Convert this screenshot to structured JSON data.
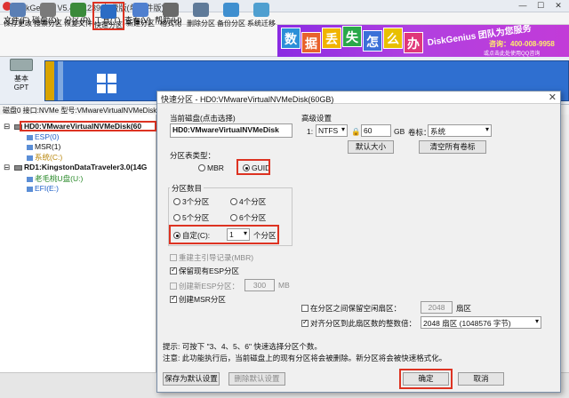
{
  "window": {
    "title": "DiskGenius V5.4.2.1239 免费版(单文件版)",
    "min": "—",
    "max": "☐",
    "close": "✕"
  },
  "menu": [
    "文件(F)",
    "磁盘(D)",
    "分区(P)",
    "工具(T)",
    "查看(V)",
    "帮助(H)"
  ],
  "toolbar": [
    {
      "label": "保存更改",
      "icon": "save-icon",
      "color": "#5a7fb5"
    },
    {
      "label": "搜索分区",
      "icon": "search-partition-icon",
      "color": "#7a7a7a"
    },
    {
      "label": "恢复文件",
      "icon": "restore-file-icon",
      "color": "#3a8a3a"
    },
    {
      "label": "快速分区",
      "icon": "quick-partition-icon",
      "color": "#2b6cc4"
    },
    {
      "label": "新建分区",
      "icon": "new-partition-icon",
      "color": "#4f7fcf"
    },
    {
      "label": "格式化",
      "icon": "format-icon",
      "color": "#6a6a6a"
    },
    {
      "label": "删除分区",
      "icon": "delete-partition-icon",
      "color": "#5f7a99"
    },
    {
      "label": "备份分区",
      "icon": "backup-partition-icon",
      "color": "#3f8fcf"
    },
    {
      "label": "系统迁移",
      "icon": "system-migrate-icon",
      "color": "#4f9fd0"
    }
  ],
  "banner": {
    "tiles": [
      {
        "text": "数",
        "color": "#2b8fd8"
      },
      {
        "text": "据",
        "color": "#e8612c"
      },
      {
        "text": "丢",
        "color": "#f0b400"
      },
      {
        "text": "失",
        "color": "#2aa84a"
      },
      {
        "text": "怎",
        "color": "#3b6fd8"
      },
      {
        "text": "么",
        "color": "#e8c000"
      },
      {
        "text": "办",
        "color": "#e0367a"
      }
    ],
    "slogan": "DiskGenius 团队为您服务",
    "phone": "咨询：400-008-9958",
    "note": "或点击此处使用QQ咨询"
  },
  "diskmap": {
    "label1": "基本",
    "label2": "GPT"
  },
  "infoline": "磁盘0 接口:NVMe  型号:VMwareVirtualNVMeDisk",
  "tree": {
    "disk0": "HD0:VMwareVirtualNVMeDisk(60",
    "disk0_parts": [
      "ESP(0)",
      "MSR(1)",
      "系统(C:)"
    ],
    "disk1": "RD1:KingstonDataTraveler3.0(14G",
    "disk1_parts": [
      "老毛桃U盘(U:)",
      "EFI(E:)"
    ]
  },
  "dialog": {
    "title": "快速分区 - HD0:VMwareVirtualNVMeDisk(60GB)",
    "current_disk_label": "当前磁盘(点击选择)",
    "current_disk_value": "HD0:VMwareVirtualNVMeDisk",
    "table_type_label": "分区表类型：",
    "mbr": "MBR",
    "guid": "GUID",
    "count_label": "分区数目",
    "counts": [
      "3个分区",
      "4个分区",
      "5个分区",
      "6个分区"
    ],
    "custom_label": "自定(C):",
    "custom_value": "1",
    "custom_unit": "个分区",
    "rebuild_mbr": "重建主引导记录(MBR)",
    "keep_esp": "保留现有ESP分区",
    "create_esp": "创建新ESP分区：",
    "esp_size": "300",
    "esp_unit": "MB",
    "create_msr": "创建MSR分区",
    "advanced_label": "高级设置",
    "part_index": "1:",
    "fs": "NTFS",
    "size": "60",
    "size_unit": "GB",
    "vol_label_caption": "卷标：",
    "vol_label": "系统",
    "default_size_btn": "默认大小",
    "clear_labels_btn": "清空所有卷标",
    "reserve_label": "在分区之间保留空闲扇区：",
    "reserve_value": "2048",
    "reserve_unit": "扇区",
    "align_label": "对齐分区到此扇区数的整数倍：",
    "align_value": "2048 扇区 (1048576 字节)",
    "tip1": "提示: 可按下 \"3、4、5、6\" 快速选择分区个数。",
    "tip2": "注意: 此功能执行后，当前磁盘上的现有分区将会被删除。新分区将会被快速格式化。",
    "save_default_btn": "保存为默认设置",
    "delete_default_btn": "删除默认设置",
    "ok_btn": "确定",
    "cancel_btn": "取消"
  }
}
